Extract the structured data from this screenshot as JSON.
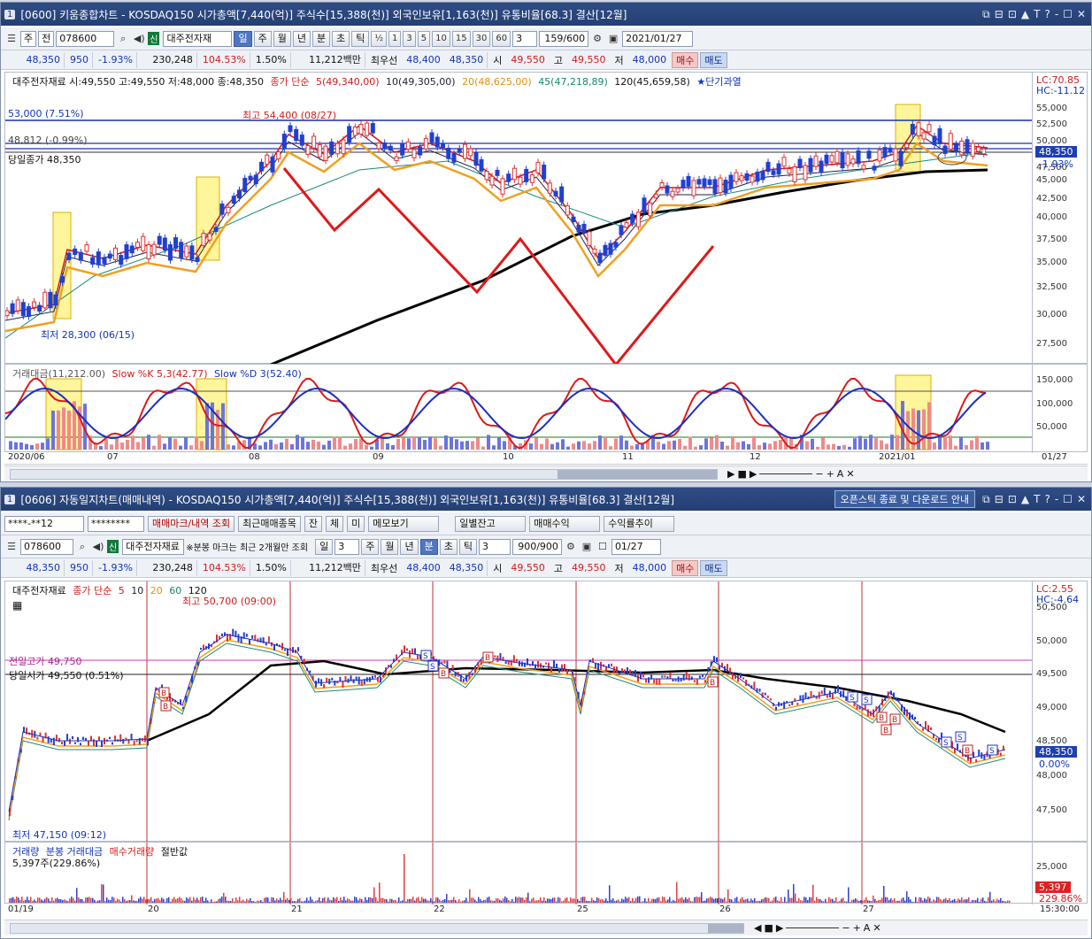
{
  "w1": {
    "num": "1",
    "title": "[0600] 키움종합차트 - KOSDAQ150 시가총액[7,440(억)] 주식수[15,388(천)] 외국인보유[1,163(천)] 유통비율[68.3] 결산[12월]",
    "win_btns": [
      "⧉",
      "⊟",
      "⊡",
      "▲",
      "T",
      "?",
      "-",
      "☐",
      "✕"
    ],
    "toolbar": {
      "mode": "주",
      "prev": "전",
      "code": "078600",
      "sin": "신",
      "name": "대주전자재",
      "periods": [
        "일",
        "주",
        "월",
        "년",
        "분",
        "초",
        "틱"
      ],
      "active_period": "일",
      "half": "½",
      "nums": [
        "1",
        "3",
        "5",
        "10",
        "15",
        "30",
        "60"
      ],
      "count_sel": "3",
      "count": "159/600",
      "date": "2021/01/27"
    },
    "quote": {
      "price": "48,350",
      "change": "950",
      "pct": "-1.93%",
      "volume": "230,248",
      "vol_ratio": "104.53%",
      "turnover": "1.50%",
      "amount": "11,212백만",
      "best_label": "최우선",
      "ask": "48,400",
      "bid": "48,350",
      "open_label": "시",
      "open": "49,550",
      "high_label": "고",
      "high": "49,550",
      "low_label": "저",
      "low": "48,000",
      "buy": "매수",
      "sell": "매도"
    },
    "legend": {
      "info": "대주전자재료 시:49,550 고:49,550 저:48,000 종:48,350",
      "ma_label": "종가 단순",
      "ma5": "5(49,340,00)",
      "ma10": "10(49,305,00)",
      "ma20": "20(48,625,00)",
      "ma45": "45(47,218,89)",
      "ma120": "120(45,659,58)",
      "signal": "★단기과열"
    },
    "tags": {
      "high": "최고 54,400 (08/27)",
      "low": "최저 28,300 (06/15)",
      "line1": "53,000 (7.51%)",
      "line2": "48,812 (-0.99%)",
      "line3": "당일종가 48,350"
    },
    "price_axis": [
      "55,000",
      "52,500",
      "50,000",
      "47,500",
      "45,000",
      "42,500",
      "40,000",
      "37,500",
      "35,000",
      "32,500",
      "30,000",
      "27,500"
    ],
    "lc": "LC:70.85",
    "hc": "HC:-11.12",
    "cur_price": "48,350",
    "cur_pct": "-1.93%",
    "sub_legend": {
      "a": "거래대금(11,212.00)",
      "b": "Slow %K 5,3(42.77)",
      "c": "Slow %D 3(52.40)"
    },
    "sub_axis": [
      "150,000",
      "100,000",
      "50,000"
    ],
    "x_labels": [
      "2020/06",
      "07",
      "08",
      "09",
      "10",
      "11",
      "12",
      "2021/01"
    ],
    "x_right": "01/27"
  },
  "w2": {
    "num": "1",
    "title": "[0606] 자동일지차트(매매내역) - KOSDAQ150 시가총액[7,440(억)] 주식수[15,388(천)] 외국인보유[1,163(천)] 유통비율[68.3] 결산[12월]",
    "notice": "오픈스틱 종료 및 다운로드 안내",
    "win_btns": [
      "⧉",
      "⊟",
      "⊡",
      "▲",
      "T",
      "?",
      "-",
      "☐",
      "✕"
    ],
    "acct": "****-**12",
    "pw": "********",
    "btns": [
      "매매마크/내역 조회",
      "최근매매종목",
      "잔",
      "체",
      "미",
      "메모보기",
      "일별잔고",
      "매매수익",
      "수익률추이"
    ],
    "toolbar": {
      "code": "078600",
      "sin": "신",
      "name": "대주전자재료",
      "note": "※분봉 마크는 최근 2개월만 조회",
      "periods": [
        "일",
        "주",
        "월",
        "년",
        "분",
        "초",
        "틱"
      ],
      "active_period": "분",
      "day_sel": "3",
      "min_sel": "3",
      "count": "900/900",
      "date": "01/27"
    },
    "quote": {
      "price": "48,350",
      "change": "950",
      "pct": "-1.93%",
      "volume": "230,248",
      "vol_ratio": "104.53%",
      "turnover": "1.50%",
      "amount": "11,212백만",
      "best_label": "최우선",
      "ask": "48,400",
      "bid": "48,350",
      "open_label": "시",
      "open": "49,550",
      "high_label": "고",
      "high": "49,550",
      "low_label": "저",
      "low": "48,000",
      "buy": "매수",
      "sell": "매도"
    },
    "legend": {
      "name": "대주전자재료",
      "ma_label": "종가 단순",
      "m5": "5",
      "m10": "10",
      "m20": "20",
      "m60": "60",
      "m120": "120"
    },
    "tags": {
      "high": "최고 50,700 (09:00)",
      "low": "최저 47,150 (09:12)",
      "prev_high": "전일고가 49,750",
      "open": "당일시가 49,550 (0.51%)"
    },
    "price_axis": [
      "50,500",
      "50,000",
      "49,500",
      "49,000",
      "48,500",
      "48,000",
      "47,500"
    ],
    "lc": "LC:2.55",
    "hc": "HC:-4.64",
    "cur_price": "48,350",
    "cur_pct": "0.00%",
    "vol_legend": {
      "a": "거래량",
      "b": "분봉 거래대금",
      "c": "매수거래량",
      "d": "절반값",
      "e": "5,397주(229.86%)"
    },
    "vol_axis": "25,000",
    "vol_badge": "5,397",
    "vol_pct": "229.86%",
    "x_labels": [
      "01/19",
      "20",
      "21",
      "22",
      "25",
      "26",
      "27"
    ],
    "x_right": "15:30:00"
  },
  "colors": {
    "up": "#e03030",
    "down": "#2040d0",
    "ma5": "#d01818",
    "ma20": "#f0a020",
    "ma120": "#000000"
  }
}
